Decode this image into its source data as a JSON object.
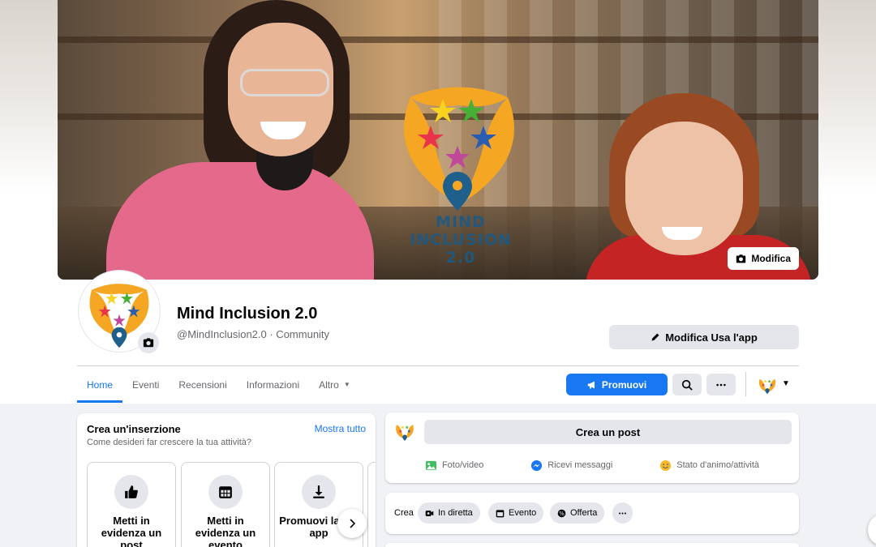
{
  "cover": {
    "logo_text_line1": "MIND INCLUSION",
    "logo_text_line2": "2.0",
    "edit_label": "Modifica"
  },
  "page": {
    "name": "Mind Inclusion 2.0",
    "subtitle": "@MindInclusion2.0 · Community",
    "edit_app_label": "Modifica Usa l'app"
  },
  "tabs": [
    {
      "label": "Home",
      "active": true
    },
    {
      "label": "Eventi"
    },
    {
      "label": "Recensioni"
    },
    {
      "label": "Informazioni"
    },
    {
      "label": "Altro"
    }
  ],
  "actions": {
    "promote_label": "Promuovi"
  },
  "create_listing": {
    "title": "Crea un'inserzione",
    "subtitle": "Come desideri far crescere la tua attività?",
    "show_all": "Mostra tutto",
    "tiles": [
      {
        "icon": "thumbs-up-icon",
        "label": "Metti in evidenza un post"
      },
      {
        "icon": "calendar-icon",
        "label": "Metti in evidenza un evento"
      },
      {
        "icon": "download-icon",
        "label": "Promuovi la tua app"
      }
    ]
  },
  "composer": {
    "create_post": "Crea un post",
    "actions": [
      {
        "icon": "photo-video-icon",
        "label": "Foto/video",
        "color": "#45bd62"
      },
      {
        "icon": "messenger-icon",
        "label": "Ricevi messaggi",
        "color": "#1877f2"
      },
      {
        "icon": "feeling-icon",
        "label": "Stato d'animo/attività",
        "color": "#f7b928"
      }
    ]
  },
  "create_bar": {
    "label": "Crea",
    "chips": [
      {
        "icon": "live-video-icon",
        "label": "In diretta"
      },
      {
        "icon": "calendar-icon",
        "label": "Evento"
      },
      {
        "icon": "offer-icon",
        "label": "Offerta"
      },
      {
        "icon": "more-icon",
        "label": ""
      }
    ]
  },
  "colors": {
    "accent": "#1877f2",
    "logo_orange": "#f5a623",
    "logo_pin": "#1f5f8b"
  }
}
